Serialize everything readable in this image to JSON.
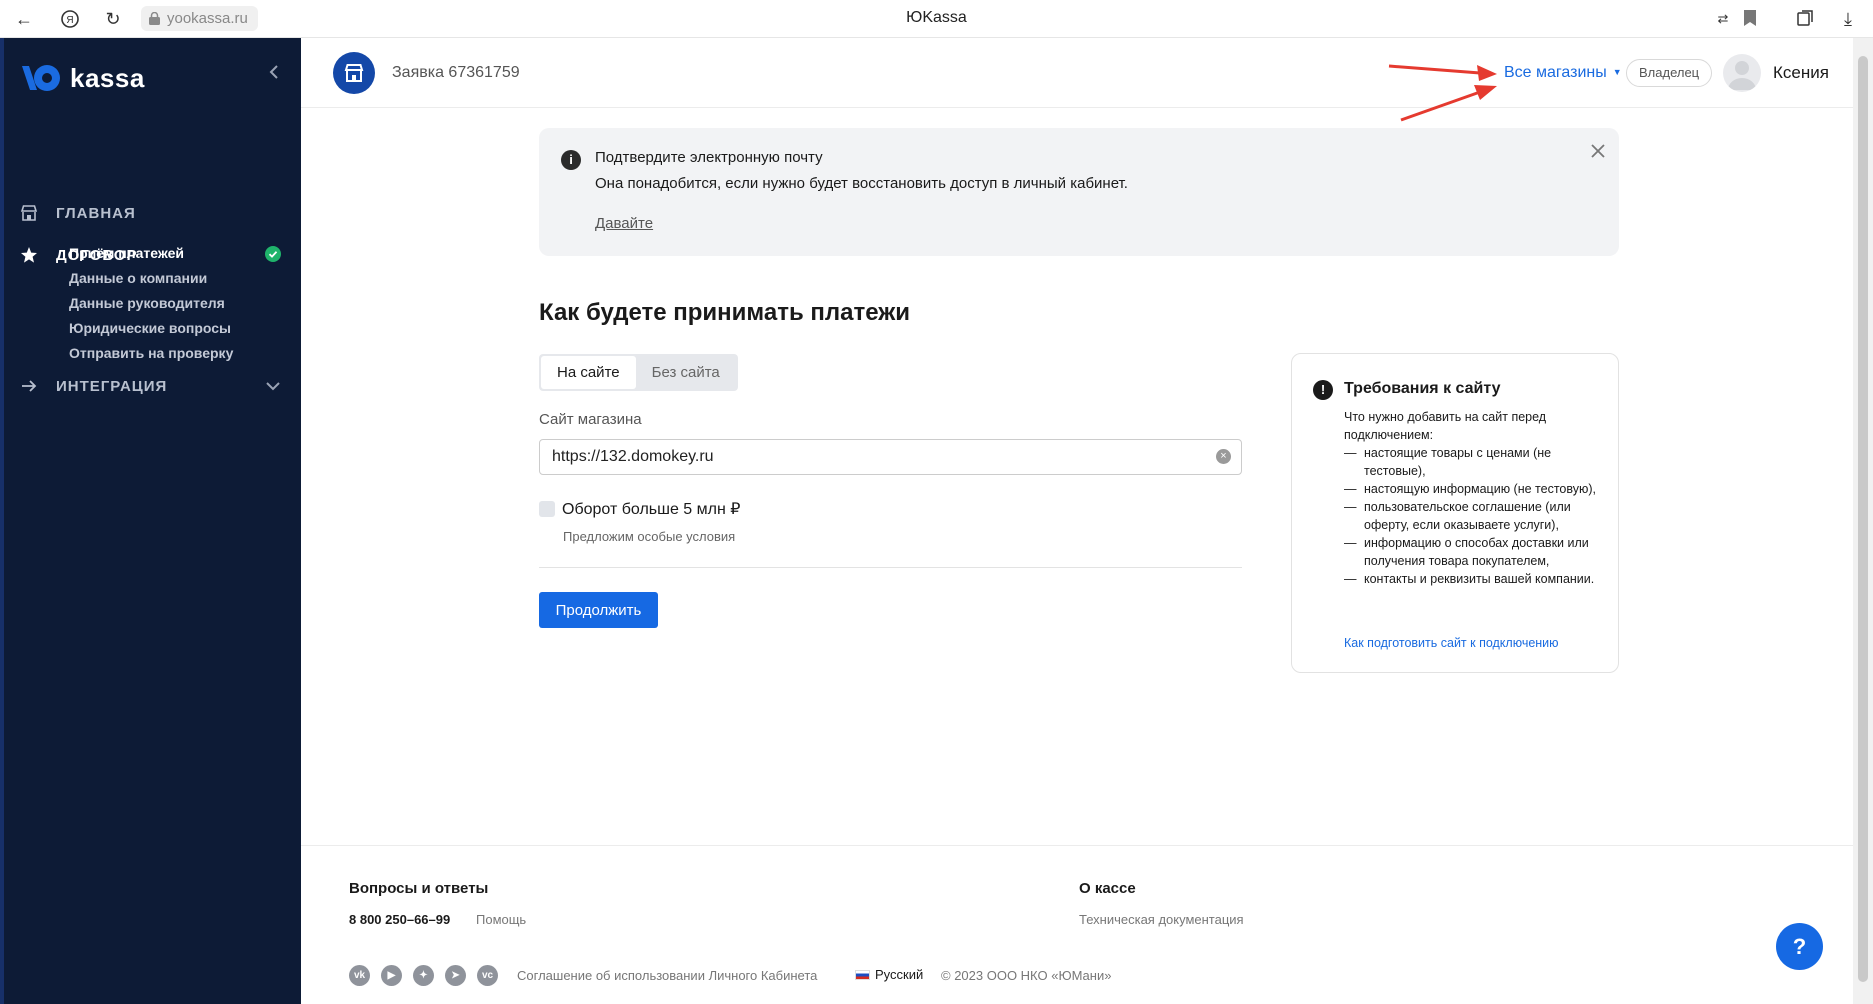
{
  "browser": {
    "url": "yookassa.ru",
    "title": "ЮKassa"
  },
  "sidebar": {
    "logo_text": "kassa",
    "nav": {
      "home": "ГЛАВНАЯ",
      "contract": "ДОГОВОР",
      "integration": "ИНТЕГРАЦИЯ"
    },
    "contract_items": [
      {
        "label": "Приём платежей",
        "active": true,
        "completed": true
      },
      {
        "label": "Данные о компании"
      },
      {
        "label": "Данные руководителя"
      },
      {
        "label": "Юридические вопросы"
      },
      {
        "label": "Отправить на проверку"
      }
    ]
  },
  "header": {
    "application": "Заявка 67361759",
    "all_shops": "Все магазины",
    "role": "Владелец",
    "user_name": "Ксения"
  },
  "notice": {
    "title": "Подтвердите электронную почту",
    "text": "Она понадобится, если нужно будет восстановить доступ в личный кабинет.",
    "link": "Давайте"
  },
  "form": {
    "title": "Как будете принимать платежи",
    "tabs": [
      "На сайте",
      "Без сайта"
    ],
    "selected_tab": "На сайте",
    "site_label": "Сайт магазина",
    "site_value": "https://132.domokey.ru",
    "turnover_label": "Оборот больше 5 млн ₽",
    "turnover_checked": false,
    "turnover_hint": "Предложим особые условия",
    "continue": "Продолжить"
  },
  "requirements": {
    "title": "Требования к сайту",
    "lead": "Что нужно добавить на сайт перед подключением:",
    "items": [
      "настоящие товары с ценами (не тестовые),",
      "настоящую информацию (не тестовую),",
      "пользовательское соглашение (или оферту, если оказываете услуги),",
      "информацию о способах доставки или получения товара покупателем,",
      "контакты и реквизиты вашей компании."
    ],
    "link": "Как подготовить сайт к подключению"
  },
  "footer": {
    "faq_title": "Вопросы и ответы",
    "phone": "8 800 250–66–99",
    "help": "Помощь",
    "about_title": "О кассе",
    "tech_docs": "Техническая документация",
    "socials": [
      "vk-icon",
      "youtube-icon",
      "zen-icon",
      "telegram-icon",
      "vc-icon"
    ],
    "agreement": "Соглашение об использовании Личного Кабинета",
    "language": "Русский",
    "copyright": "© 2023 ООО НКО «ЮМани»",
    "help_fab": "?"
  },
  "colors": {
    "sidebar_bg": "#0d1b36",
    "accent": "#1669e3",
    "link": "#1a6be0",
    "success": "#1fb36b",
    "annotation_arrow": "#e53a2f"
  }
}
